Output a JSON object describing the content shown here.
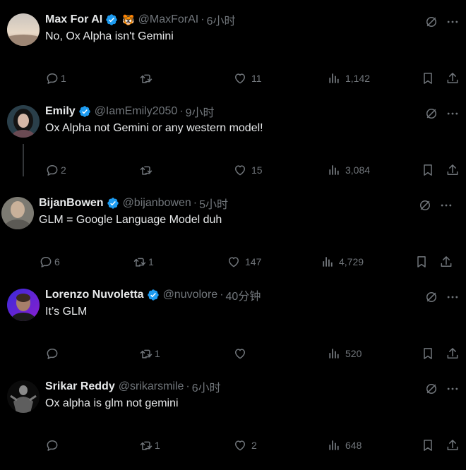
{
  "tweets": [
    {
      "name": "Max For AI",
      "handle": "@MaxForAI",
      "time": "6小时",
      "text": "No, Ox Alpha isn't Gemini",
      "reply_count": "1",
      "retweet_count": "",
      "like_count": "11",
      "view_count": "1,142",
      "has_emoji_badge": true
    },
    {
      "name": "Emily",
      "handle": "@IamEmily2050",
      "time": "9小时",
      "text": "Ox Alpha not Gemini or any western model!",
      "reply_count": "2",
      "retweet_count": "",
      "like_count": "15",
      "view_count": "3,084"
    },
    {
      "name": "BijanBowen",
      "handle": "@bijanbowen",
      "time": "5小时",
      "text": "GLM = Google Language Model duh",
      "reply_count": "6",
      "retweet_count": "1",
      "like_count": "147",
      "view_count": "4,729"
    },
    {
      "name": "Lorenzo Nuvoletta",
      "handle": "@nuvolore",
      "time": "40分钟",
      "text": "It’s GLM",
      "reply_count": "",
      "retweet_count": "1",
      "like_count": "",
      "view_count": "520"
    },
    {
      "name": "Srikar Reddy",
      "handle": "@srikarsmile",
      "time": "6小时",
      "text": "Ox alpha is glm not gemini",
      "reply_count": "",
      "retweet_count": "1",
      "like_count": "2",
      "view_count": "648"
    }
  ],
  "colors": {
    "background": "#000000",
    "text": "#e7e9ea",
    "muted": "#71767b",
    "verified": "#1d9bf0"
  },
  "icons": [
    "verified-badge-icon",
    "grok-icon",
    "more-icon",
    "reply-icon",
    "retweet-icon",
    "like-icon",
    "views-icon",
    "bookmark-icon",
    "share-icon"
  ]
}
